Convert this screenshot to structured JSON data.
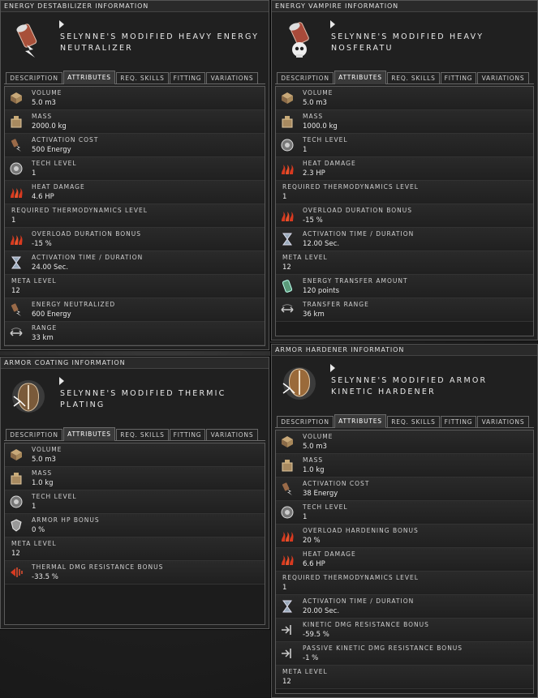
{
  "tab_labels": [
    "Description",
    "Attributes",
    "Req. Skills",
    "Fitting",
    "Variations"
  ],
  "windows": [
    {
      "title": "ENERGY DESTABILIZER INFORMATION",
      "name": "SELYNNE'S MODIFIED HEAVY ENERGY NEUTRALIZER",
      "icon": "energy-neutralizer-icon",
      "rows": [
        {
          "icon": "volume-icon",
          "label": "Volume",
          "value": "5.0 m3"
        },
        {
          "icon": "mass-icon",
          "label": "Mass",
          "value": "2000.0 kg"
        },
        {
          "icon": "activation-cost-icon",
          "label": "Activation Cost",
          "value": "500 Energy"
        },
        {
          "icon": "tech-level-icon",
          "label": "Tech Level",
          "value": "1"
        },
        {
          "icon": "heat-icon",
          "label": "Heat Damage",
          "value": "4.6 HP"
        },
        {
          "icon": "",
          "label": "Required Thermodynamics Level",
          "value": "1"
        },
        {
          "icon": "heat-icon",
          "label": "Overload Duration Bonus",
          "value": "-15 %"
        },
        {
          "icon": "hourglass-icon",
          "label": "Activation time / duration",
          "value": "24.00 Sec."
        },
        {
          "icon": "",
          "label": "Meta Level",
          "value": "12"
        },
        {
          "icon": "activation-cost-icon",
          "label": "Energy Neutralized",
          "value": "600 Energy"
        },
        {
          "icon": "range-icon",
          "label": "Range",
          "value": "33 km"
        }
      ]
    },
    {
      "title": "ENERGY VAMPIRE INFORMATION",
      "name": "SELYNNE'S MODIFIED HEAVY NOSFERATU",
      "icon": "nosferatu-icon",
      "rows": [
        {
          "icon": "volume-icon",
          "label": "Volume",
          "value": "5.0 m3"
        },
        {
          "icon": "mass-icon",
          "label": "Mass",
          "value": "1000.0 kg"
        },
        {
          "icon": "tech-level-icon",
          "label": "Tech Level",
          "value": "1"
        },
        {
          "icon": "heat-icon",
          "label": "Heat Damage",
          "value": "2.3 HP"
        },
        {
          "icon": "",
          "label": "Required Thermodynamics Level",
          "value": "1"
        },
        {
          "icon": "heat-icon",
          "label": "Overload Duration Bonus",
          "value": "-15 %"
        },
        {
          "icon": "hourglass-icon",
          "label": "Activation time / duration",
          "value": "12.00 Sec."
        },
        {
          "icon": "",
          "label": "Meta Level",
          "value": "12"
        },
        {
          "icon": "energy-transfer-icon",
          "label": "Energy Transfer Amount",
          "value": "120 points"
        },
        {
          "icon": "range-icon",
          "label": "Transfer Range",
          "value": "36 km"
        }
      ]
    },
    {
      "title": "ARMOR COATING INFORMATION",
      "name": "SELYNNE'S MODIFIED THERMIC PLATING",
      "icon": "armor-plating-icon",
      "rows": [
        {
          "icon": "volume-icon",
          "label": "Volume",
          "value": "5.0 m3"
        },
        {
          "icon": "mass-icon",
          "label": "Mass",
          "value": "1.0 kg"
        },
        {
          "icon": "tech-level-icon",
          "label": "Tech Level",
          "value": "1"
        },
        {
          "icon": "armor-hp-icon",
          "label": "Armor HP Bonus",
          "value": "0 %"
        },
        {
          "icon": "",
          "label": "Meta Level",
          "value": "12"
        },
        {
          "icon": "thermal-resist-icon",
          "label": "Thermal dmg resistance bonus",
          "value": "-33.5 %"
        }
      ]
    },
    {
      "title": "ARMOR HARDENER INFORMATION",
      "name": "SELYNNE'S MODIFIED ARMOR KINETIC HARDENER",
      "icon": "armor-hardener-icon",
      "rows": [
        {
          "icon": "volume-icon",
          "label": "Volume",
          "value": "5.0 m3"
        },
        {
          "icon": "mass-icon",
          "label": "Mass",
          "value": "1.0 kg"
        },
        {
          "icon": "activation-cost-icon",
          "label": "Activation Cost",
          "value": "38 Energy"
        },
        {
          "icon": "tech-level-icon",
          "label": "Tech Level",
          "value": "1"
        },
        {
          "icon": "heat-icon",
          "label": "Overload Hardening Bonus",
          "value": "20 %"
        },
        {
          "icon": "heat-icon",
          "label": "Heat Damage",
          "value": "6.6 HP"
        },
        {
          "icon": "",
          "label": "Required Thermodynamics Level",
          "value": "1"
        },
        {
          "icon": "hourglass-icon",
          "label": "Activation time / duration",
          "value": "20.00 Sec."
        },
        {
          "icon": "kinetic-resist-icon",
          "label": "Kinetic dmg resistance bonus",
          "value": "-59.5 %"
        },
        {
          "icon": "kinetic-resist-icon",
          "label": "Passive kinetic dmg resistance bonus",
          "value": "-1 %"
        },
        {
          "icon": "",
          "label": "Meta Level",
          "value": "12"
        }
      ]
    }
  ]
}
